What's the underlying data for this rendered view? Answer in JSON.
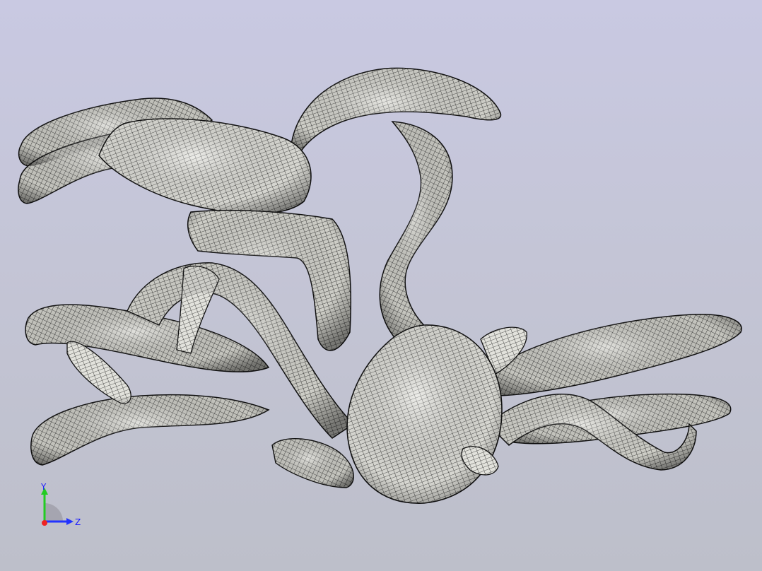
{
  "viewport": {
    "background_top": "#c9c9e2",
    "background_bottom": "#bdbfca",
    "mesh_color": "#1a1a1a",
    "surface_color": "#d8d8d0"
  },
  "triad": {
    "y_label": "Y",
    "z_label": "Z",
    "y_color": "#22cc22",
    "z_color": "#2233ff",
    "x_color": "#ee2222"
  }
}
